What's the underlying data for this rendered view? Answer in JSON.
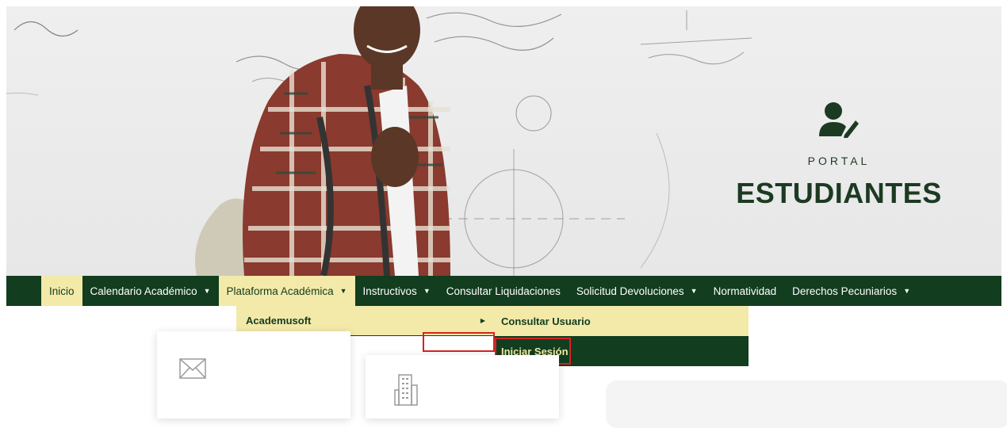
{
  "hero": {
    "kicker": "PORTAL",
    "title": "ESTUDIANTES",
    "icon": "user-edit-icon",
    "brand_color": "#1c3a22"
  },
  "nav": {
    "items": [
      {
        "label": "Inicio",
        "has_caret": false
      },
      {
        "label": "Calendario Académico",
        "has_caret": true
      },
      {
        "label": "Plataforma Académica",
        "has_caret": true
      },
      {
        "label": "Instructivos",
        "has_caret": true
      },
      {
        "label": "Consultar Liquidaciones",
        "has_caret": false
      },
      {
        "label": "Solicitud Devoluciones",
        "has_caret": true
      },
      {
        "label": "Normatividad",
        "has_caret": false
      },
      {
        "label": "Derechos Pecuniarios",
        "has_caret": true
      }
    ],
    "caret": "▼",
    "bar_color": "#123d1f",
    "highlight_color": "#f3e9a9"
  },
  "dropdown": {
    "label": "Academusoft",
    "arrow": "▶",
    "submenu": [
      {
        "label": "Consultar Usuario"
      },
      {
        "label": "Iniciar Sesión"
      }
    ]
  },
  "cards": [
    {
      "icon": "envelope-icon"
    },
    {
      "icon": "building-icon"
    }
  ]
}
